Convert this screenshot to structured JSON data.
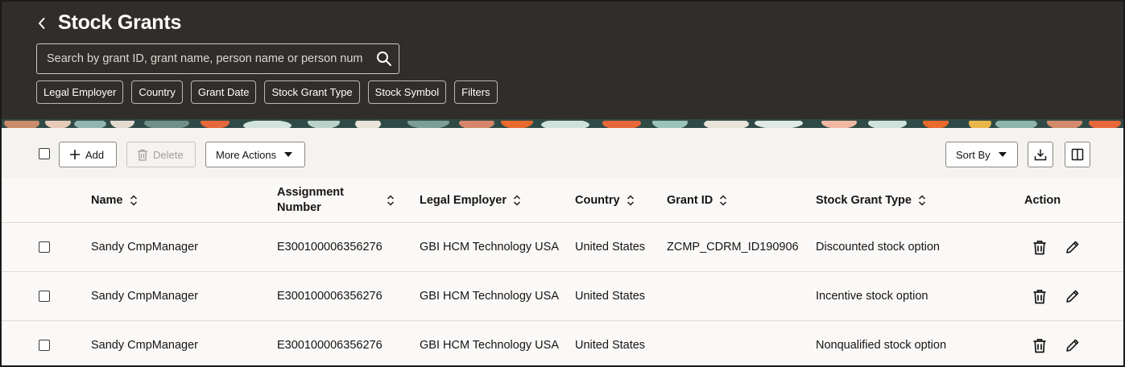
{
  "header": {
    "title": "Stock Grants",
    "search": {
      "placeholder": "Search by grant ID, grant name, person name or person number",
      "value": ""
    },
    "filter_chips": [
      {
        "label": "Legal Employer"
      },
      {
        "label": "Country"
      },
      {
        "label": "Grant Date"
      },
      {
        "label": "Stock Grant Type"
      },
      {
        "label": "Stock Symbol"
      },
      {
        "label": "Filters"
      }
    ]
  },
  "toolbar": {
    "add_label": "Add",
    "delete_label": "Delete",
    "more_actions_label": "More Actions",
    "sort_by_label": "Sort By"
  },
  "table": {
    "columns": {
      "name": "Name",
      "assignment_number": "Assignment Number",
      "legal_employer": "Legal Employer",
      "country": "Country",
      "grant_id": "Grant ID",
      "stock_grant_type": "Stock Grant Type",
      "action": "Action"
    },
    "rows": [
      {
        "name": "Sandy CmpManager",
        "assignment_number": "E300100006356276",
        "legal_employer": "GBI HCM Technology USA",
        "country": "United States",
        "grant_id": "ZCMP_CDRM_ID190906",
        "stock_grant_type": "Discounted stock option"
      },
      {
        "name": "Sandy CmpManager",
        "assignment_number": "E300100006356276",
        "legal_employer": "GBI HCM Technology USA",
        "country": "United States",
        "grant_id": "",
        "stock_grant_type": "Incentive stock option"
      },
      {
        "name": "Sandy CmpManager",
        "assignment_number": "E300100006356276",
        "legal_employer": "GBI HCM Technology USA",
        "country": "United States",
        "grant_id": "",
        "stock_grant_type": "Nonqualified stock option"
      }
    ]
  },
  "colors": {
    "header_bg": "#312d2a",
    "page_bg": "#fbf9f8",
    "toolbar_bg": "#f5f3f0"
  }
}
